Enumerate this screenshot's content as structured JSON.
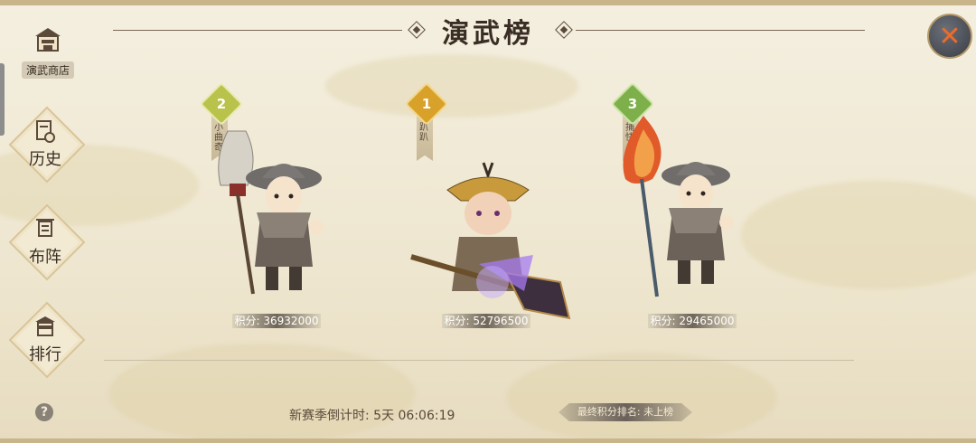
{
  "header": {
    "title": "演武榜"
  },
  "close_icon": "close-x-icon",
  "shop": {
    "label": "演武商店",
    "icon": "shop-house-icon"
  },
  "side_nav": [
    {
      "label": "历史",
      "icon": "history-scroll-icon"
    },
    {
      "label": "布阵",
      "icon": "banner-formation-icon"
    },
    {
      "label": "排行",
      "icon": "ranking-pavilion-icon"
    }
  ],
  "podium": [
    {
      "rank": "2",
      "name": "小曲奇",
      "score_label": "积分: 36932000",
      "medal_color": "#b9c24a"
    },
    {
      "rank": "1",
      "name": "趴趴",
      "score_label": "积分: 52796500",
      "medal_color": "#d8a12a"
    },
    {
      "rank": "3",
      "name": "捕快",
      "score_label": "积分: 29465000",
      "medal_color": "#7db04a"
    }
  ],
  "footer": {
    "countdown": "新赛季倒计时: 5天 06:06:19",
    "final_rank": "最终积分排名: 未上榜",
    "help": "?"
  }
}
